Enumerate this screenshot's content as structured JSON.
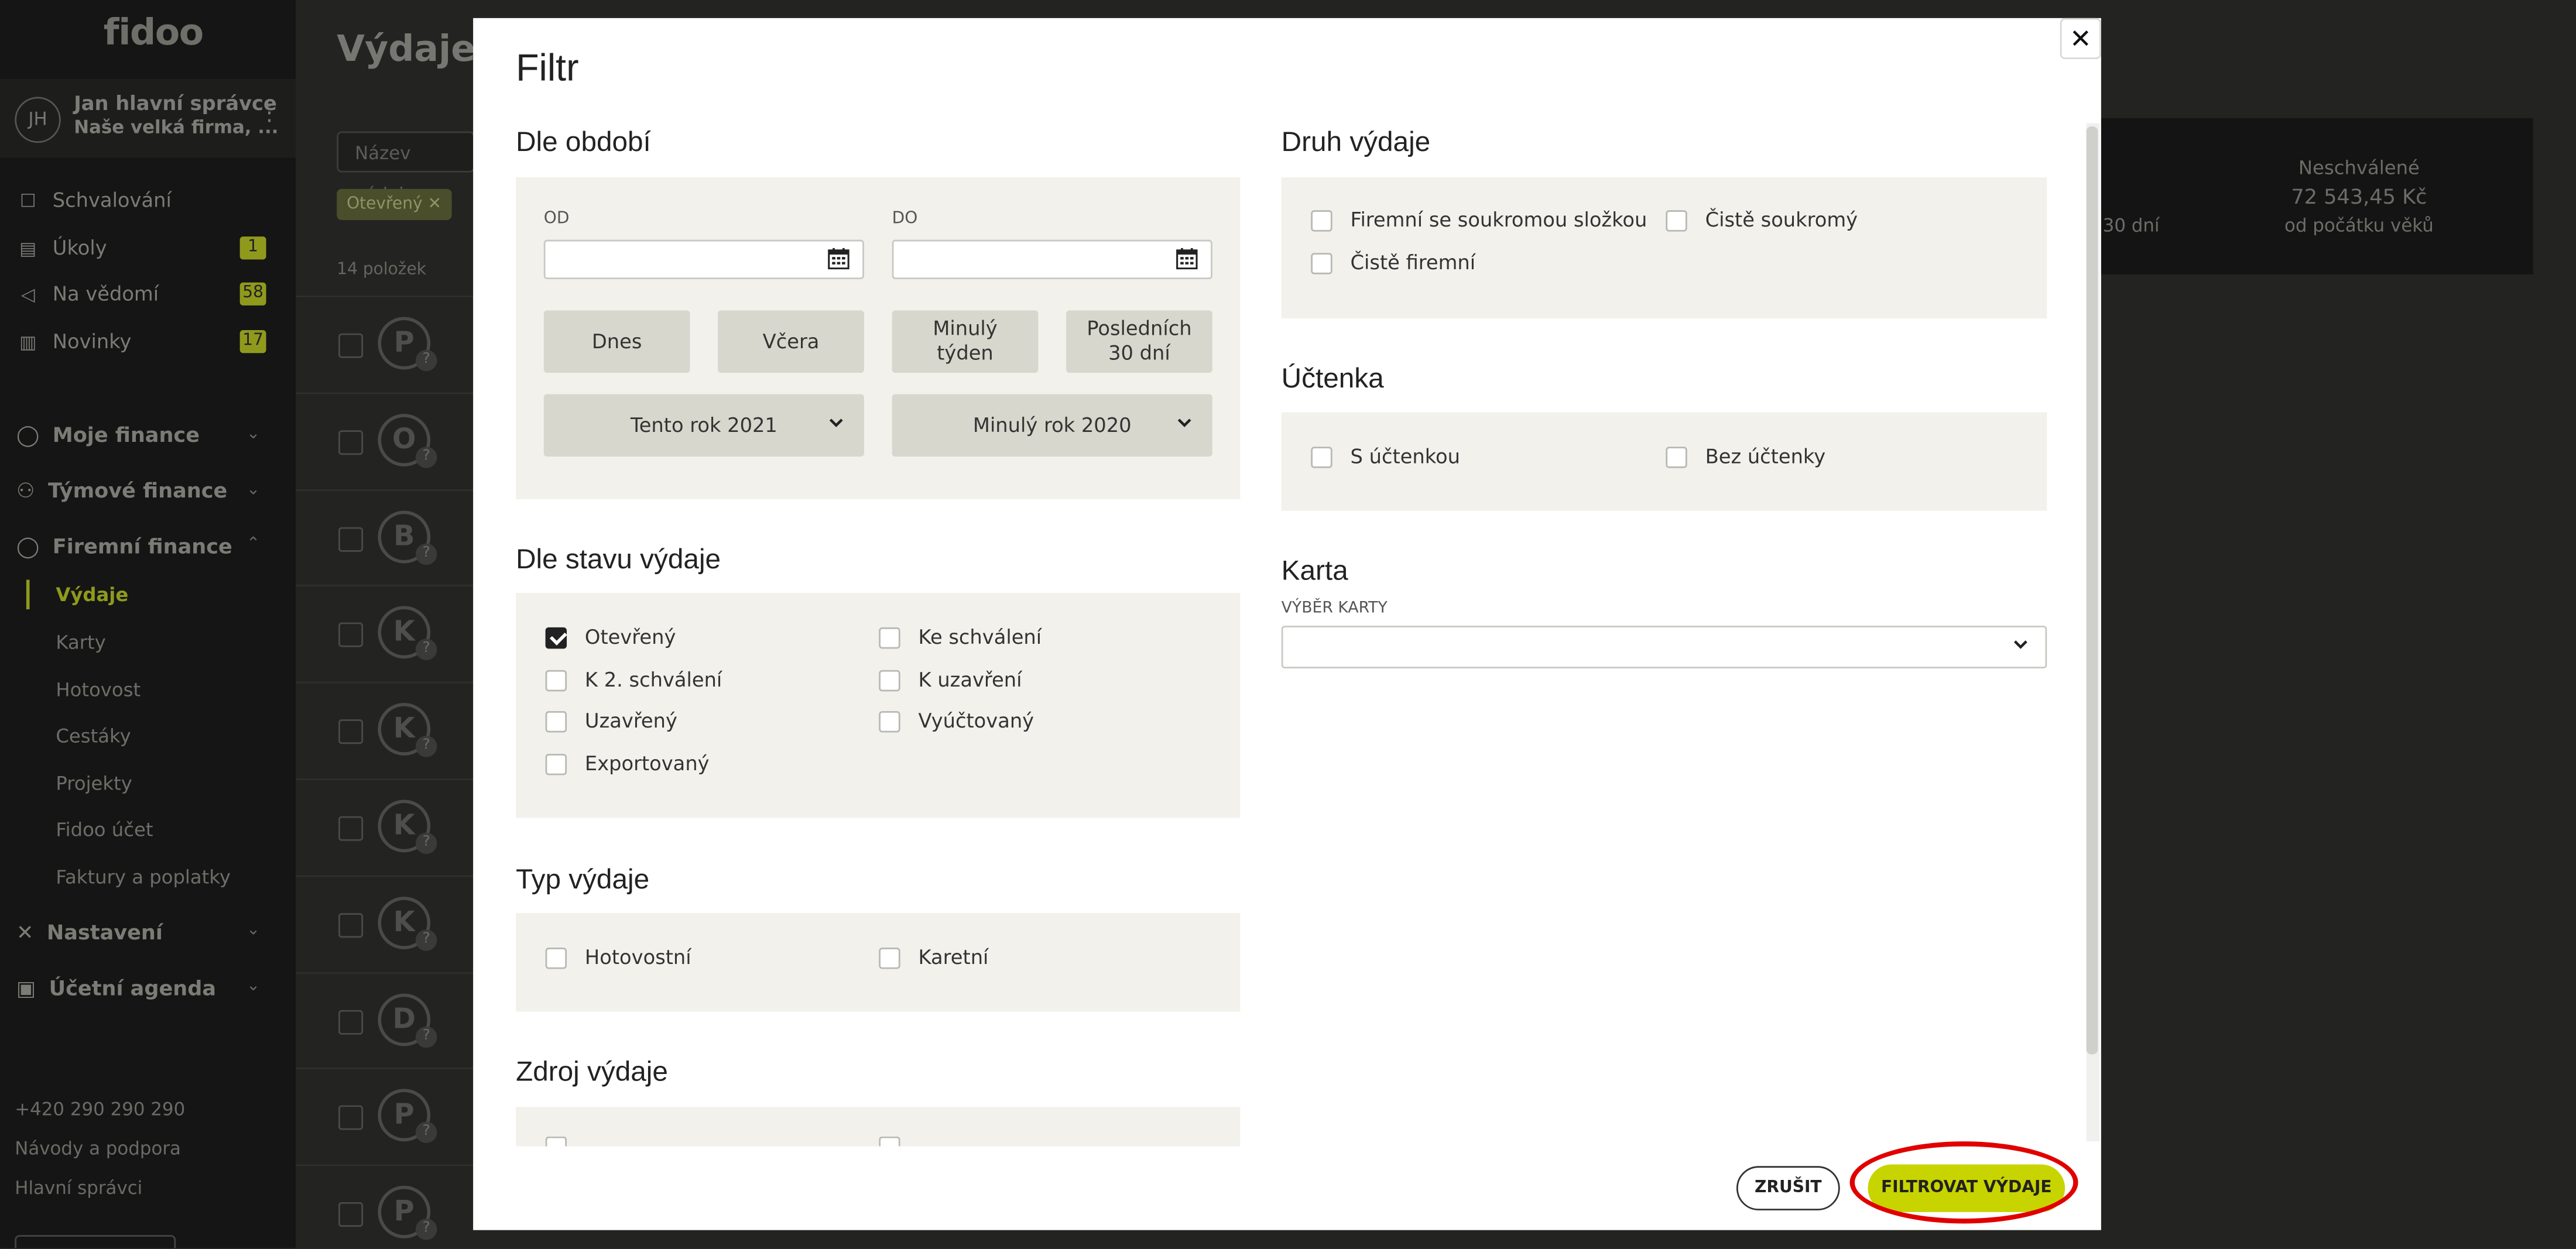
{
  "colors": {
    "accent": "#c8d400",
    "highlight": "#e00000",
    "panel_bg": "#f2f1ec",
    "preset_btn": "#d7d7cd"
  },
  "sidebar": {
    "logo": "fidoo",
    "avatar_initials": "JH",
    "user_name": "Jan hlavní správce",
    "company": "Naše velká firma, ...",
    "items": [
      {
        "label": "Schvalování",
        "icon": "approval-icon"
      },
      {
        "label": "Úkoly",
        "badge": "1",
        "icon": "clipboard-icon"
      },
      {
        "label": "Na vědomí",
        "badge": "58",
        "icon": "megaphone-icon"
      },
      {
        "label": "Novinky",
        "badge": "17",
        "icon": "news-icon"
      }
    ],
    "sections": [
      {
        "label": "Moje finance",
        "icon": "user-icon"
      },
      {
        "label": "Týmové finance",
        "icon": "team-icon"
      },
      {
        "label": "Firemní finance",
        "icon": "company-icon"
      }
    ],
    "sub_items": [
      "Výdaje",
      "Karty",
      "Hotovost",
      "Cestáky",
      "Projekty",
      "Fidoo účet",
      "Faktury a poplatky"
    ],
    "sections2": [
      {
        "label": "Nastavení",
        "icon": "settings-icon"
      },
      {
        "label": "Účetní agenda",
        "icon": "accounting-icon"
      }
    ],
    "footer": [
      "+420 290 290 290",
      "Návody a podpora",
      "Hlavní správci"
    ]
  },
  "main": {
    "title": "Výdaje",
    "search_placeholder": "Název výdaje n",
    "chip": "Otevřený",
    "count": "14 položek",
    "rows": [
      "P",
      "O",
      "B",
      "K",
      "K",
      "K",
      "K",
      "D",
      "P",
      "P"
    ],
    "stats": {
      "label": "Neschválené",
      "value": "72 543,45 Kč",
      "sub": "od počátku věků",
      "left_sub": "30 dní"
    }
  },
  "modal": {
    "title": "Filtr",
    "period": {
      "title": "Dle období",
      "from_label": "OD",
      "to_label": "DO",
      "btn_today": "Dnes",
      "btn_yesterday": "Včera",
      "btn_last_week": "Minulý týden",
      "btn_last30": "Posledních 30 dní",
      "year_this": "Tento rok 2021",
      "year_last": "Minulý rok 2020"
    },
    "status": {
      "title": "Dle stavu výdaje",
      "options": [
        {
          "label": "Otevřený",
          "checked": true
        },
        {
          "label": "Ke schválení",
          "checked": false
        },
        {
          "label": "K 2. schválení",
          "checked": false
        },
        {
          "label": "K uzavření",
          "checked": false
        },
        {
          "label": "Uzavřený",
          "checked": false
        },
        {
          "label": "Vyúčtovaný",
          "checked": false
        },
        {
          "label": "Exportovaný",
          "checked": false
        }
      ]
    },
    "type": {
      "title": "Typ výdaje",
      "options": [
        "Hotovostní",
        "Karetní"
      ]
    },
    "source": {
      "title": "Zdroj výdaje"
    },
    "kind": {
      "title": "Druh výdaje",
      "options": [
        "Firemní se soukromou složkou",
        "Čistě soukromý",
        "Čistě firemní"
      ]
    },
    "receipt": {
      "title": "Účtenka",
      "options": [
        "S účtenkou",
        "Bez účtenky"
      ]
    },
    "card": {
      "title": "Karta",
      "field_label": "VÝBĚR KARTY",
      "value": ""
    },
    "cancel": "ZRUŠIT",
    "apply": "FILTROVAT VÝDAJE"
  }
}
